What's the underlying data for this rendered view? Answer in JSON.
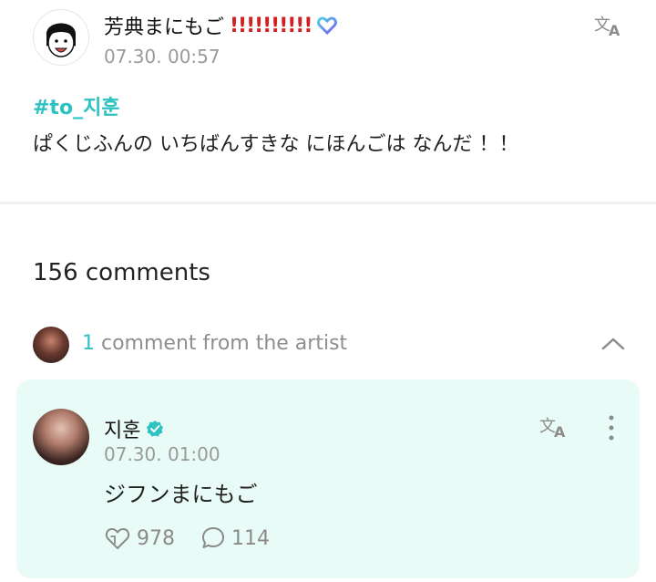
{
  "post": {
    "author": "芳典まにもご",
    "author_exclaim": "!!!!!!!!!!",
    "time": "07.30. 00:57",
    "hashtag": "#to_지훈",
    "text": "ぱくじふんの いちばんすきな にほんごは なんだ ！！"
  },
  "comments": {
    "count_label": "156 comments"
  },
  "artist_comments": {
    "count": "1",
    "label": "comment from the artist"
  },
  "artist_comment": {
    "author": "지훈",
    "time": "07.30. 01:00",
    "text": "ジフンまにもご",
    "likes": "978",
    "replies": "114"
  },
  "colors": {
    "accent": "#2ec2c2",
    "card_bg": "#e9fbf7",
    "exclaim": "#d21f1f",
    "muted": "#9a9a9a"
  },
  "icons": [
    "translate-icon",
    "heart-gradient-icon",
    "verified-icon",
    "chevron-up-icon",
    "more-vertical-icon",
    "like-icon",
    "comment-icon"
  ]
}
